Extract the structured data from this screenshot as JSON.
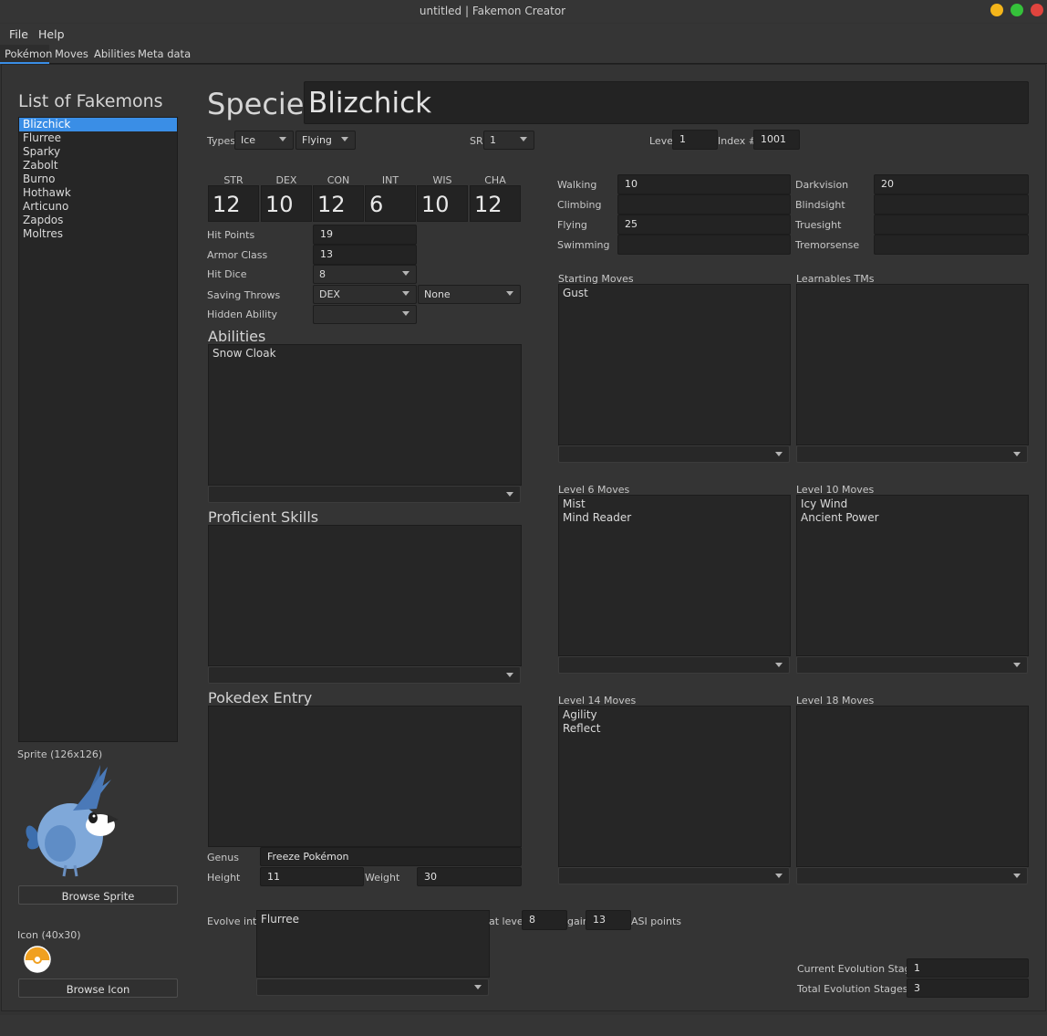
{
  "window": {
    "title": "untitled | Fakemon Creator"
  },
  "menu": [
    "File",
    "Help"
  ],
  "tabs": [
    "Pokémon",
    "Moves",
    "Abilities",
    "Meta data"
  ],
  "colors": {
    "close": "#e0443e",
    "minimize": "#f4b51a",
    "maximize": "#35c13a",
    "selection": "#3a8ee6",
    "background": "#323232"
  },
  "sidebar": {
    "title": "List of Fakemons",
    "items": [
      "Blizchick",
      "Flurree",
      "Sparky",
      "Zabolt",
      "Burno",
      "Hothawk",
      "Articuno",
      "Zapdos",
      "Moltres"
    ],
    "selected": "Blizchick",
    "sprite_label": "Sprite (126x126)",
    "browse_sprite": "Browse Sprite",
    "icon_label": "Icon (40x30)",
    "browse_icon": "Browse Icon"
  },
  "species": {
    "label": "Species",
    "value": "Blizchick"
  },
  "types": {
    "label": "Types",
    "type1": "Ice",
    "type2": "Flying"
  },
  "sr": {
    "label": "SR",
    "value": "1"
  },
  "level": {
    "label": "Level",
    "value": "1"
  },
  "index": {
    "label": "Index #",
    "value": "1001"
  },
  "stats": {
    "headers": [
      "STR",
      "DEX",
      "CON",
      "INT",
      "WIS",
      "CHA"
    ],
    "values": [
      "12",
      "10",
      "12",
      "6",
      "10",
      "12"
    ]
  },
  "vitals": {
    "hp_label": "Hit Points",
    "hp": "19",
    "ac_label": "Armor Class",
    "ac": "13",
    "hd_label": "Hit Dice",
    "hd": "8",
    "st_label": "Saving Throws",
    "st1": "DEX",
    "st2": "None",
    "ha_label": "Hidden Ability",
    "ha": ""
  },
  "abilities": {
    "title": "Abilities",
    "items": [
      "Snow Cloak"
    ]
  },
  "skills": {
    "title": "Proficient Skills",
    "items": []
  },
  "pokedex": {
    "title": "Pokedex Entry",
    "text": "",
    "genus_label": "Genus",
    "genus": "Freeze Pokémon",
    "height_label": "Height",
    "height": "11",
    "weight_label": "Weight",
    "weight": "30"
  },
  "speeds": {
    "walking_label": "Walking",
    "walking": "10",
    "climbing_label": "Climbing",
    "climbing": "",
    "flying_label": "Flying",
    "flying": "25",
    "swimming_label": "Swimming",
    "swimming": ""
  },
  "senses": {
    "darkvision_label": "Darkvision",
    "darkvision": "20",
    "blindsight_label": "Blindsight",
    "blindsight": "",
    "truesight_label": "Truesight",
    "truesight": "",
    "tremorsense_label": "Tremorsense",
    "tremorsense": ""
  },
  "moves": {
    "starting": {
      "title": "Starting Moves",
      "items": [
        "Gust"
      ]
    },
    "tms": {
      "title": "Learnables TMs",
      "items": []
    },
    "lvl6": {
      "title": "Level 6 Moves",
      "items": [
        "Mist",
        "Mind Reader"
      ]
    },
    "lvl10": {
      "title": "Level 10 Moves",
      "items": [
        "Icy Wind",
        "Ancient Power"
      ]
    },
    "lvl14": {
      "title": "Level 14 Moves",
      "items": [
        "Agility",
        "Reflect"
      ]
    },
    "lvl18": {
      "title": "Level 18 Moves",
      "items": []
    }
  },
  "evolution": {
    "label": "Evolve into",
    "items": [
      "Flurree"
    ],
    "at_level_label": "at level",
    "at_level": "8",
    "gain_label": "gain",
    "gain": "13",
    "asi_label": "ASI points",
    "current_label": "Current Evolution Stages",
    "current": "1",
    "total_label": "Total Evolution Stages",
    "total": "3"
  }
}
